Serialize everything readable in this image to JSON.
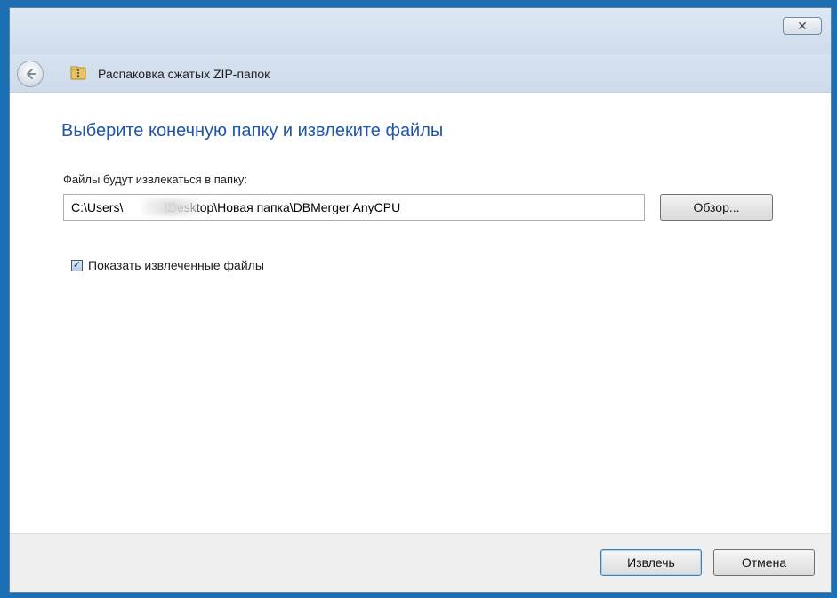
{
  "window": {
    "close_symbol": "✕",
    "nav_title": "Распаковка сжатых ZIP-папок",
    "back_icon": "back-arrow-icon",
    "zip_icon": "zip-folder-icon"
  },
  "main": {
    "heading": "Выберите конечную папку и извлеките файлы",
    "destination_label": "Файлы будут извлекаться в папку:",
    "path_value": "C:\\Users\\            \\Desktop\\Новая папка\\DBMerger AnyCPU",
    "browse_label": "Обзор...",
    "show_files_checked": true,
    "show_files_label": "Показать извлеченные файлы"
  },
  "footer": {
    "extract_label": "Извлечь",
    "cancel_label": "Отмена"
  },
  "colors": {
    "frame": "#1d6fb4",
    "heading": "#1f56a8"
  }
}
